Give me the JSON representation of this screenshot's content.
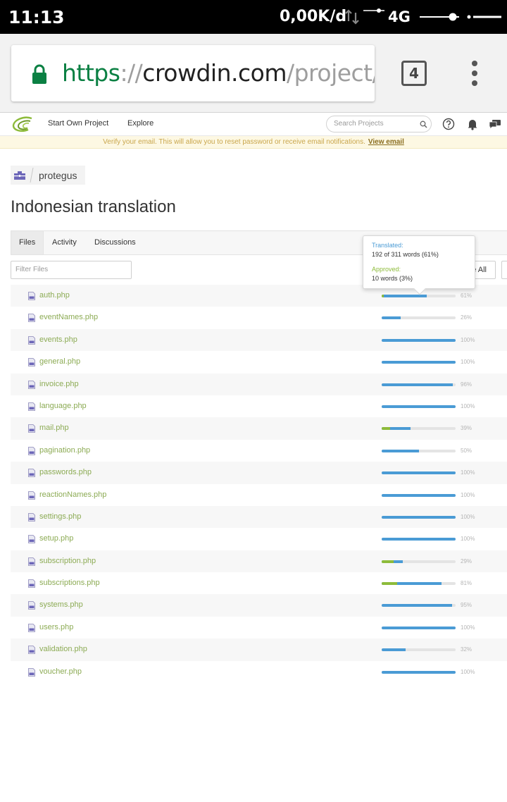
{
  "status_bar": {
    "time": "11:13",
    "speed": "0,00K/d",
    "network": "4G"
  },
  "browser": {
    "url_scheme": "https",
    "url_separator": "://",
    "url_host": "crowdin.com",
    "url_path": "/project/p",
    "tab_count": "4"
  },
  "header": {
    "nav": [
      "Start Own Project",
      "Explore"
    ],
    "search_placeholder": "Search Projects"
  },
  "notice": {
    "text": "Verify your email. This will allow you to reset password or receive email notifications.",
    "link": "View email"
  },
  "breadcrumb": {
    "project": "protegus"
  },
  "page_title": "Indonesian translation",
  "tabs": [
    "Files",
    "Activity",
    "Discussions"
  ],
  "active_tab": "Files",
  "filter_placeholder": "Filter Files",
  "select_all_label": "e All",
  "tooltip": {
    "translated_label": "Translated:",
    "translated_value": "192 of 311 words (61%)",
    "approved_label": "Approved:",
    "approved_value": "10 words (3%)"
  },
  "colors": {
    "translated_bar": "#4a9bd5",
    "approved_bar": "#8dbb3a",
    "file_link": "#8cab54"
  },
  "files": [
    {
      "name": "auth.php",
      "percent": "61%",
      "translated": 61,
      "approved": 3
    },
    {
      "name": "eventNames.php",
      "percent": "26%",
      "translated": 26,
      "approved": 0
    },
    {
      "name": "events.php",
      "percent": "100%",
      "translated": 100,
      "approved": 0
    },
    {
      "name": "general.php",
      "percent": "100%",
      "translated": 100,
      "approved": 0
    },
    {
      "name": "invoice.php",
      "percent": "96%",
      "translated": 96,
      "approved": 0
    },
    {
      "name": "language.php",
      "percent": "100%",
      "translated": 100,
      "approved": 0
    },
    {
      "name": "mail.php",
      "percent": "39%",
      "translated": 39,
      "approved": 11
    },
    {
      "name": "pagination.php",
      "percent": "50%",
      "translated": 50,
      "approved": 0
    },
    {
      "name": "passwords.php",
      "percent": "100%",
      "translated": 100,
      "approved": 0
    },
    {
      "name": "reactionNames.php",
      "percent": "100%",
      "translated": 100,
      "approved": 0
    },
    {
      "name": "settings.php",
      "percent": "100%",
      "translated": 100,
      "approved": 0
    },
    {
      "name": "setup.php",
      "percent": "100%",
      "translated": 100,
      "approved": 0
    },
    {
      "name": "subscription.php",
      "percent": "29%",
      "translated": 29,
      "approved": 16
    },
    {
      "name": "subscriptions.php",
      "percent": "81%",
      "translated": 81,
      "approved": 21
    },
    {
      "name": "systems.php",
      "percent": "95%",
      "translated": 95,
      "approved": 0
    },
    {
      "name": "users.php",
      "percent": "100%",
      "translated": 100,
      "approved": 0
    },
    {
      "name": "validation.php",
      "percent": "32%",
      "translated": 32,
      "approved": 0
    },
    {
      "name": "voucher.php",
      "percent": "100%",
      "translated": 100,
      "approved": 0
    }
  ]
}
